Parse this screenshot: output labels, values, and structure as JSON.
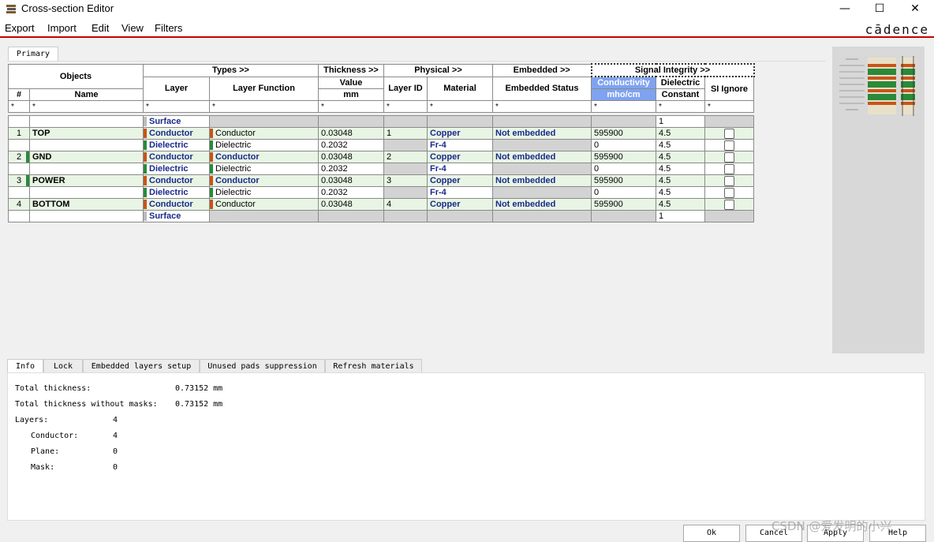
{
  "window": {
    "title": "Cross-section Editor",
    "min": "—",
    "max": "☐",
    "close": "✕"
  },
  "menu": [
    "Export",
    "Import",
    "Edit",
    "View",
    "Filters"
  ],
  "brand": "cādence",
  "tab_primary": "Primary",
  "header": {
    "objects": "Objects",
    "types": "Types >>",
    "thickness": "Thickness >>",
    "physical": "Physical >>",
    "embedded": "Embedded >>",
    "signal": "Signal Integrity >>",
    "num": "#",
    "name": "Name",
    "layer": "Layer",
    "layer_function": "Layer Function",
    "value": "Value",
    "mm": "mm",
    "layer_id": "Layer ID",
    "material": "Material",
    "embedded_status": "Embedded Status",
    "conductivity": "Conductivity",
    "mho": "mho/cm",
    "dielectric": "Dielectric",
    "constant": "Constant",
    "si_ignore": "SI Ignore"
  },
  "filter_symbol": "*",
  "rows": [
    {
      "num": "",
      "name": "",
      "layer": "Surface",
      "func": "",
      "thick": "",
      "id": "",
      "mat": "",
      "emb": "",
      "cond": "",
      "diel": "1",
      "kind": "surface"
    },
    {
      "num": "1",
      "name": "TOP",
      "layer": "Conductor",
      "func": "Conductor",
      "thick": "0.03048",
      "id": "1",
      "mat": "Copper",
      "emb": "Not embedded",
      "cond": "595900",
      "diel": "4.5",
      "kind": "cond"
    },
    {
      "num": "",
      "name": "",
      "layer": "Dielectric",
      "func": "Dielectric",
      "thick": "0.2032",
      "id": "",
      "mat": "Fr-4",
      "emb": "",
      "cond": "0",
      "diel": "4.5",
      "kind": "diel"
    },
    {
      "num": "2",
      "name": "GND",
      "layer": "Conductor",
      "func": "Conductor",
      "thick": "0.03048",
      "id": "2",
      "mat": "Copper",
      "emb": "Not embedded",
      "cond": "595900",
      "diel": "4.5",
      "kind": "cond"
    },
    {
      "num": "",
      "name": "",
      "layer": "Dielectric",
      "func": "Dielectric",
      "thick": "0.2032",
      "id": "",
      "mat": "Fr-4",
      "emb": "",
      "cond": "0",
      "diel": "4.5",
      "kind": "diel"
    },
    {
      "num": "3",
      "name": "POWER",
      "layer": "Conductor",
      "func": "Conductor",
      "thick": "0.03048",
      "id": "3",
      "mat": "Copper",
      "emb": "Not embedded",
      "cond": "595900",
      "diel": "4.5",
      "kind": "cond"
    },
    {
      "num": "",
      "name": "",
      "layer": "Dielectric",
      "func": "Dielectric",
      "thick": "0.2032",
      "id": "",
      "mat": "Fr-4",
      "emb": "",
      "cond": "0",
      "diel": "4.5",
      "kind": "diel"
    },
    {
      "num": "4",
      "name": "BOTTOM",
      "layer": "Conductor",
      "func": "Conductor",
      "thick": "0.03048",
      "id": "4",
      "mat": "Copper",
      "emb": "Not embedded",
      "cond": "595900",
      "diel": "4.5",
      "kind": "cond"
    },
    {
      "num": "",
      "name": "",
      "layer": "Surface",
      "func": "",
      "thick": "",
      "id": "",
      "mat": "",
      "emb": "",
      "cond": "",
      "diel": "1",
      "kind": "surface"
    }
  ],
  "bottom_tabs": [
    "Info",
    "Lock",
    "Embedded layers setup",
    "Unused pads suppression",
    "Refresh materials"
  ],
  "info": {
    "total_thickness_label": "Total thickness:",
    "total_thickness_value": "0.73152 mm",
    "total_no_masks_label": "Total thickness without masks:",
    "total_no_masks_value": "0.73152 mm",
    "layers_label": "Layers:",
    "layers_value": "4",
    "conductor_label": "Conductor:",
    "conductor_value": "4",
    "plane_label": "Plane:",
    "plane_value": "0",
    "mask_label": "Mask:",
    "mask_value": "0"
  },
  "buttons": {
    "ok": "Ok",
    "cancel": "Cancel",
    "apply": "Apply",
    "help": "Help"
  },
  "watermark": "CSDN @爱发明的小兴",
  "colors": {
    "conductor_marker": "#c8541a",
    "dielectric_marker": "#2a8a3a",
    "conductor_row": "#e8f5e4",
    "header_highlight": "#7fa3f0",
    "title_rule": "#c80000"
  }
}
